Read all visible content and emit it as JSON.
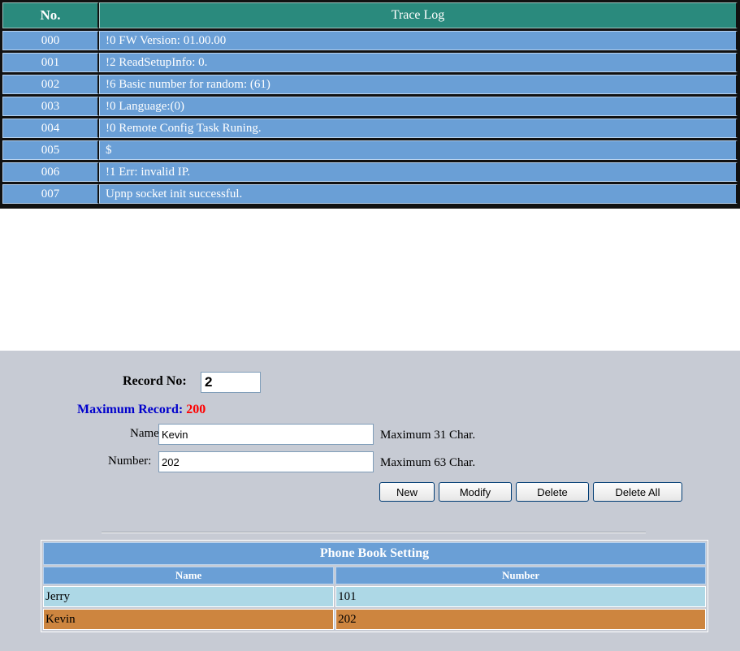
{
  "trace_log": {
    "headers": {
      "no": "No.",
      "log": "Trace Log"
    },
    "rows": [
      {
        "no": "000",
        "text": "!0 FW Version: 01.00.00"
      },
      {
        "no": "001",
        "text": "!2 ReadSetupInfo: 0."
      },
      {
        "no": "002",
        "text": "!6 Basic number for random: (61)"
      },
      {
        "no": "003",
        "text": "!0 Language:(0)"
      },
      {
        "no": "004",
        "text": "!0 Remote Config Task Runing."
      },
      {
        "no": "005",
        "text": "$"
      },
      {
        "no": "006",
        "text": "!1 Err: invalid IP."
      },
      {
        "no": "007",
        "text": "Upnp socket init successful."
      }
    ]
  },
  "form": {
    "record_label": "Record No:",
    "record_value": "2",
    "max_record_label": "Maximum Record:",
    "max_record_value": "200",
    "name_label": "Name:",
    "name_value": "Kevin",
    "name_hint": "Maximum 31 Char.",
    "number_label": "Number:",
    "number_value": "202",
    "number_hint": "Maximum 63 Char.",
    "buttons": {
      "new": "New",
      "modify": "Modify",
      "delete": "Delete",
      "delete_all": "Delete All"
    }
  },
  "phone_book": {
    "title": "Phone Book Setting",
    "columns": {
      "name": "Name",
      "number": "Number"
    },
    "rows": [
      {
        "name": "Jerry",
        "number": "101"
      },
      {
        "name": "Kevin",
        "number": "202"
      }
    ]
  },
  "colors": {
    "header_teal": "#2a8a7d",
    "row_blue": "#6a9fd6",
    "panel_gray": "#c7cbd4",
    "max_label_blue": "#0000cc",
    "max_value_red": "#ff0000",
    "row_light_blue": "#add8e6",
    "row_selected_orange": "#cd853f"
  }
}
